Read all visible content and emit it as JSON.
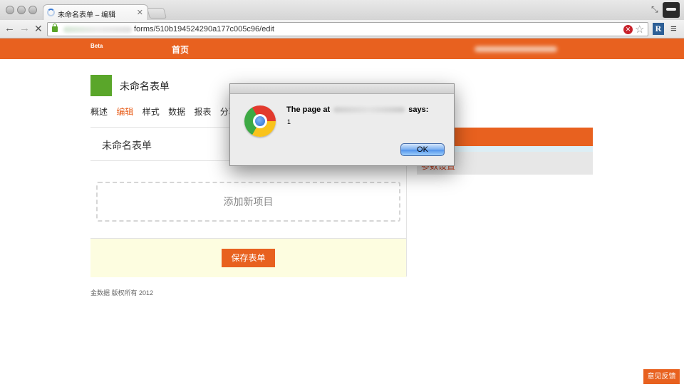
{
  "browser": {
    "tab_title": "未命名表单 – 编辑",
    "url_path": "forms/510b194524290a177c005c96/edit"
  },
  "site": {
    "beta_label": "Beta",
    "home_label": "首页"
  },
  "form": {
    "title": "未命名表单",
    "nav": [
      "概述",
      "编辑",
      "样式",
      "数据",
      "报表",
      "分享"
    ],
    "active_nav": "编辑",
    "editor_title": "未命名表单",
    "add_item_label": "添加新项目",
    "save_label": "保存表单"
  },
  "right_panel": {
    "link_label": "参数设置"
  },
  "footer": {
    "copyright": "金数据 版权所有 2012"
  },
  "feedback_label": "意见反馈",
  "dialog": {
    "prefix": "The page at",
    "suffix": "says:",
    "message": "1",
    "ok_label": "OK"
  },
  "colors": {
    "brand_orange": "#e8611f",
    "logo_green": "#5aa62a",
    "save_area_bg": "#fdfde0"
  },
  "icons": [
    "spinner-icon",
    "close-icon",
    "back-icon",
    "forward-icon",
    "stop-icon",
    "lock-icon",
    "star-icon",
    "extension-icon",
    "menu-icon",
    "chrome-logo-icon"
  ]
}
